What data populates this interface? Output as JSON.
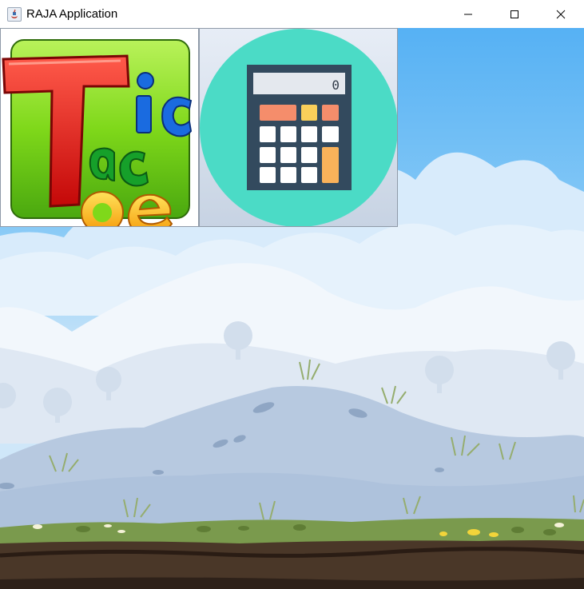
{
  "window": {
    "title": "RAJA Application",
    "controls": [
      "minimize-icon",
      "maximize-icon",
      "close-icon"
    ]
  },
  "launchers": {
    "tictactoe": {
      "logo_letters": [
        "T",
        "ic",
        "ac",
        "oe"
      ],
      "icon": "tic-tac-toe-logo-icon"
    },
    "calculator": {
      "icon": "calculator-icon",
      "display_value": "0"
    }
  },
  "colors": {
    "sky": "#56b1f4",
    "calculator_circle": "#4bdbc6",
    "calculator_body": "#334a5e",
    "calculator_orange": "#f9b25a",
    "calculator_coral": "#f58d6b",
    "logo_green": "#86e41a",
    "logo_red": "#e30f0f",
    "logo_blue": "#1363d1",
    "ground": "#7a9a4d",
    "soil": "#3a2a20"
  }
}
